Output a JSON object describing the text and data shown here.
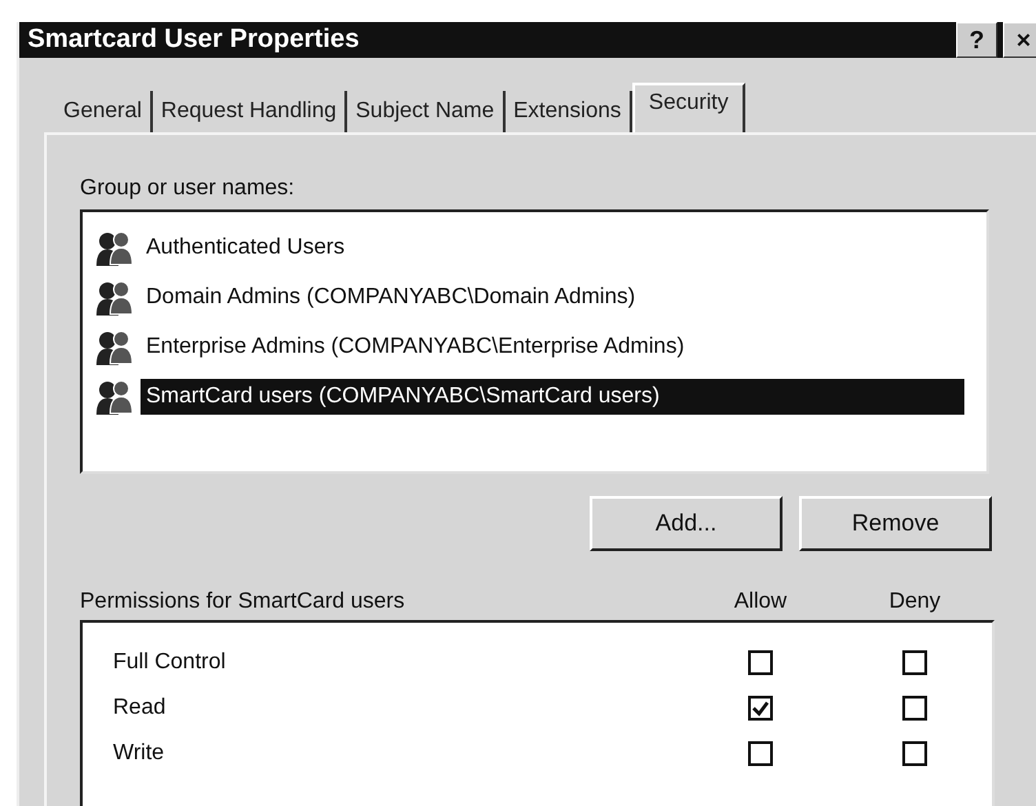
{
  "window": {
    "title": "Smartcard User Properties",
    "title_buttons": [
      "?",
      "×"
    ]
  },
  "tabs": [
    {
      "label": "General",
      "selected": false
    },
    {
      "label": "Request Handling",
      "selected": false
    },
    {
      "label": "Subject Name",
      "selected": false
    },
    {
      "label": "Extensions",
      "selected": false
    },
    {
      "label": "Security",
      "selected": true
    }
  ],
  "group_list": {
    "label": "Group or user names:",
    "items": [
      {
        "name": "Authenticated Users",
        "selected": false
      },
      {
        "name": "Domain Admins (COMPANYABC\\Domain Admins)",
        "selected": false
      },
      {
        "name": "Enterprise Admins (COMPANYABC\\Enterprise Admins)",
        "selected": false
      },
      {
        "name": "SmartCard users (COMPANYABC\\SmartCard users)",
        "selected": true
      }
    ]
  },
  "buttons": [
    "Add...",
    "Remove"
  ],
  "permissions": {
    "label": "Permissions for SmartCard users",
    "columns": [
      "Allow",
      "Deny"
    ],
    "rows": [
      {
        "name": "Full Control",
        "allow": false,
        "deny": false
      },
      {
        "name": "Read",
        "allow": true,
        "deny": false
      },
      {
        "name": "Write",
        "allow": false,
        "deny": false
      }
    ]
  }
}
